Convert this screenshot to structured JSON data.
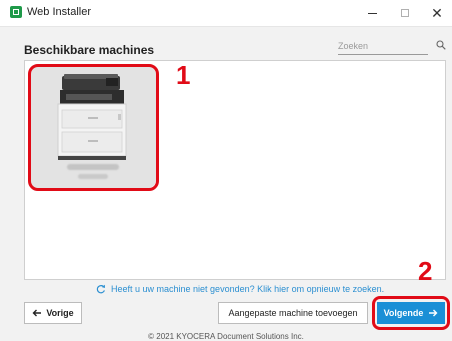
{
  "window": {
    "title": "Web Installer",
    "icon": "web-installer-app-icon",
    "minimize_label": "–",
    "maximize_label": "",
    "close_label": "✕"
  },
  "header": {
    "title": "Beschikbare machines",
    "search_placeholder": "Zoeken",
    "search_value": ""
  },
  "machines": [
    {
      "icon": "printer-icon",
      "name": "",
      "selected": true
    }
  ],
  "callouts": {
    "one": "1",
    "two": "2",
    "color": "#e10b17"
  },
  "notfound": {
    "text": "Heeft u uw machine niet gevonden? Klik hier om opnieuw te zoeken.",
    "icon": "refresh-icon"
  },
  "buttons": {
    "back": "Vorige",
    "custom": "Aangepaste machine toevoegen",
    "next": "Volgende"
  },
  "footer": "© 2021 KYOCERA Document Solutions Inc.",
  "colors": {
    "accent": "#1a8fd6",
    "link": "#2b8fd1",
    "highlight": "#e10b17",
    "app_icon": "#1f9a4a"
  }
}
